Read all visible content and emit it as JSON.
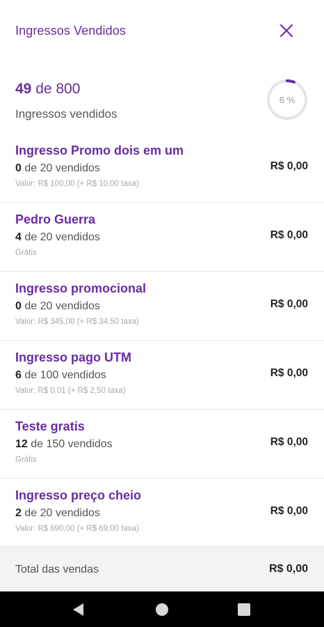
{
  "header": {
    "title": "Ingressos Vendidos",
    "close_icon": "close-icon"
  },
  "summary": {
    "sold": "49",
    "of": "de",
    "total": "800",
    "label": "Ingressos vendidos",
    "percent": 0.06,
    "percent_label": "6 %"
  },
  "tickets": [
    {
      "name": "Ingresso Promo dois em um",
      "sold": "0",
      "of_text": "de 20 vendidos",
      "price_info": "Valor: R$ 100,00 (+ R$ 10,00 taxa)",
      "total": "R$ 0,00"
    },
    {
      "name": "Pedro Guerra",
      "sold": "4",
      "of_text": "de 20 vendidos",
      "price_info": "Grátis",
      "total": "R$ 0,00"
    },
    {
      "name": "Ingresso promocional",
      "sold": "0",
      "of_text": "de 20 vendidos",
      "price_info": "Valor: R$ 345,00 (+ R$ 34,50 taxa)",
      "total": "R$ 0,00"
    },
    {
      "name": "Ingresso pago UTM",
      "sold": "6",
      "of_text": "de 100 vendidos",
      "price_info": "Valor: R$ 0,01 (+ R$ 2,50 taxa)",
      "total": "R$ 0,00"
    },
    {
      "name": "Teste gratis",
      "sold": "12",
      "of_text": "de 150 vendidos",
      "price_info": "Grátis",
      "total": "R$ 0,00"
    },
    {
      "name": "Ingresso preço cheio",
      "sold": "2",
      "of_text": "de 20 vendidos",
      "price_info": "Valor: R$ 690,00 (+ R$ 69,00 taxa)",
      "total": "R$ 0,00"
    }
  ],
  "footer": {
    "label": "Total das vendas",
    "value": "R$ 0,00"
  },
  "navbar": {
    "back_icon": "back-triangle-icon",
    "home_icon": "home-circle-icon",
    "recents_icon": "recents-square-icon"
  },
  "colors": {
    "accent": "#6a2ca0",
    "ring_track": "#e4e4e4"
  }
}
